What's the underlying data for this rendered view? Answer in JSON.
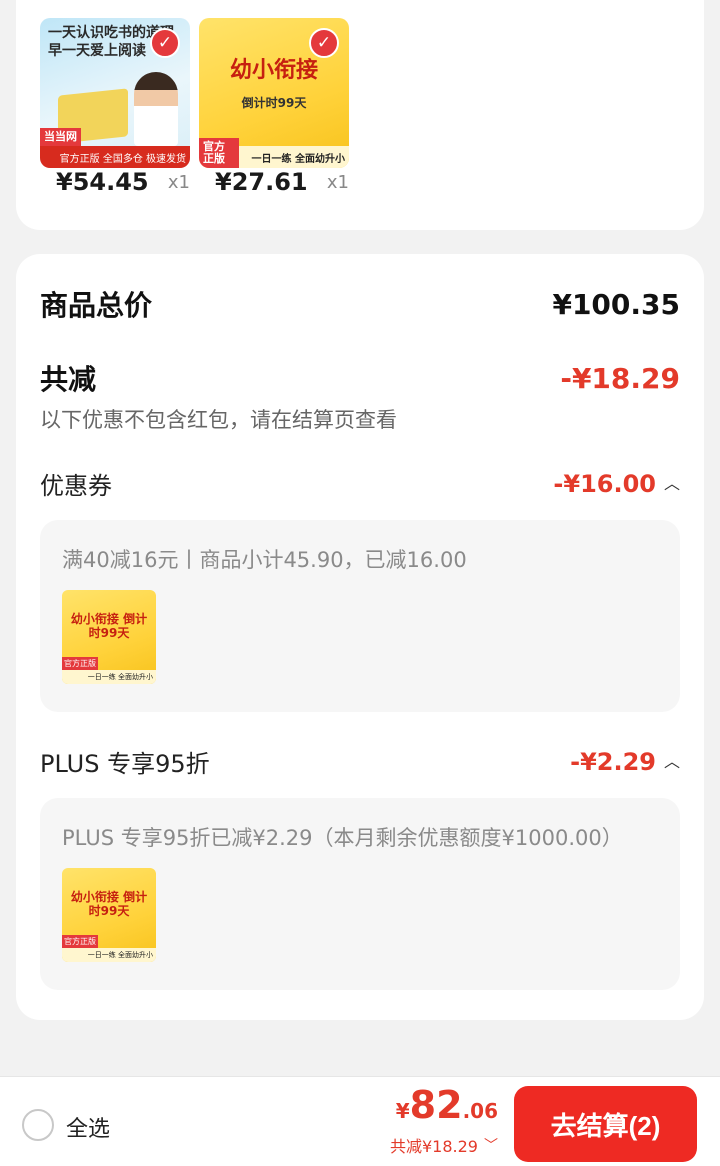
{
  "products": [
    {
      "price": "¥54.45",
      "qty": "x1",
      "title": "一天认识吃书的道理 早一天爱上阅读",
      "badge": "当当网",
      "strip": "官方正版 全国多仓 极速发货"
    },
    {
      "price": "¥27.61",
      "qty": "x1",
      "title": "幼小衔接",
      "subtitle": "倒计时99天",
      "badge": "官方正版",
      "strip": "一日一练 全面幼升小"
    }
  ],
  "summary": {
    "total_label": "商品总价",
    "total_value": "¥100.35",
    "reduce_label": "共减",
    "reduce_value": "-¥18.29",
    "note": "以下优惠不包含红包，请在结算页查看"
  },
  "coupon": {
    "label": "优惠券",
    "value": "-¥16.00",
    "detail": "满40减16元丨商品小计45.90，已减16.00",
    "thumb_title": "幼小衔接 倒计时99天",
    "thumb_badge": "官方正版",
    "thumb_strip": "一日一练 全面幼升小"
  },
  "plus": {
    "label": "PLUS 专享95折",
    "value": "-¥2.29",
    "detail": "PLUS 专享95折已减¥2.29（本月剩余优惠额度¥1000.00）",
    "thumb_title": "幼小衔接 倒计时99天",
    "thumb_badge": "官方正版",
    "thumb_strip": "一日一练 全面幼升小"
  },
  "bottom": {
    "select_all": "全选",
    "price_symbol": "¥",
    "price_int": "82",
    "price_dec": ".06",
    "save_text": "共减¥18.29",
    "checkout": "去结算(2)"
  },
  "colors": {
    "accent": "#ee2a23",
    "discount": "#e33a2a"
  },
  "icons": {
    "selected": "check-icon",
    "expand": "chevron-up-icon",
    "details": "chevron-down-icon"
  }
}
